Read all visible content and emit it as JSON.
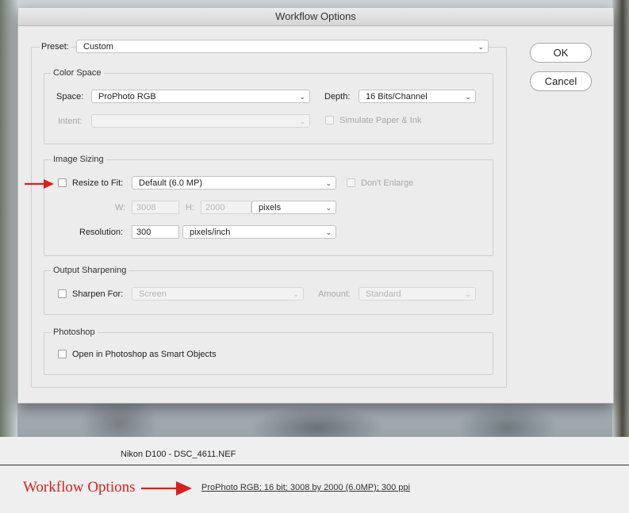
{
  "dialog": {
    "title": "Workflow Options",
    "ok_label": "OK",
    "cancel_label": "Cancel",
    "preset": {
      "label": "Preset:",
      "value": "Custom"
    }
  },
  "color_space": {
    "title": "Color Space",
    "space_label": "Space:",
    "space_value": "ProPhoto RGB",
    "depth_label": "Depth:",
    "depth_value": "16 Bits/Channel",
    "intent_label": "Intent:",
    "intent_value": "",
    "simulate_label": "Simulate Paper & Ink"
  },
  "image_sizing": {
    "title": "Image Sizing",
    "resize_label": "Resize to Fit:",
    "resize_value": "Default  (6.0 MP)",
    "dont_enlarge_label": "Don't Enlarge",
    "w_label": "W:",
    "w_value": "3008",
    "h_label": "H:",
    "h_value": "2000",
    "unit_value": "pixels",
    "resolution_label": "Resolution:",
    "resolution_value": "300",
    "resolution_unit": "pixels/inch"
  },
  "output_sharpening": {
    "title": "Output Sharpening",
    "sharpen_label": "Sharpen For:",
    "sharpen_value": "Screen",
    "amount_label": "Amount:",
    "amount_value": "Standard"
  },
  "photoshop": {
    "title": "Photoshop",
    "smart_objects_label": "Open in Photoshop as Smart Objects"
  },
  "footer": {
    "camera_info": "Nikon D100  -  DSC_4611.NEF",
    "workflow_label": "Workflow Options",
    "workflow_link": "ProPhoto RGB; 16 bit; 3008 by 2000 (6.0MP); 300 ppi"
  },
  "colors": {
    "annotation_red": "#d8211f"
  }
}
